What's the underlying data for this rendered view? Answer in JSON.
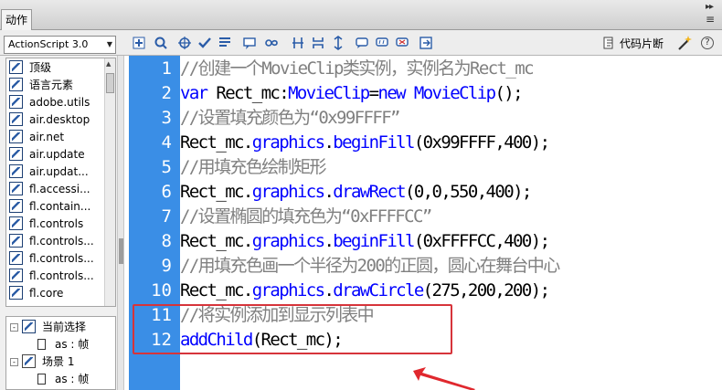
{
  "window": {
    "panel_tab": "动作"
  },
  "toolbar": {
    "language_select": "ActionScript 3.0",
    "tool_icons": [
      "add-statement-icon",
      "find-icon",
      "target-path-icon",
      "check-syntax-icon",
      "auto-format-icon",
      "code-hint-icon",
      "debug-options-icon",
      "collapse-braces-icon",
      "collapse-selection-icon",
      "expand-all-icon",
      "apply-block-comment-icon",
      "apply-line-comment-icon",
      "remove-comment-icon",
      "show-hide-toolbox-icon"
    ],
    "snippets_label": "代码片断",
    "help_label": "?"
  },
  "sidebar": {
    "items": [
      {
        "label": "顶级"
      },
      {
        "label": "语言元素"
      },
      {
        "label": "adobe.utils"
      },
      {
        "label": "air.desktop"
      },
      {
        "label": "air.net"
      },
      {
        "label": "air.update"
      },
      {
        "label": "air.updat..."
      },
      {
        "label": "fl.accessi..."
      },
      {
        "label": "fl.contain..."
      },
      {
        "label": "fl.controls"
      },
      {
        "label": "fl.controls..."
      },
      {
        "label": "fl.controls..."
      },
      {
        "label": "fl.controls..."
      },
      {
        "label": "fl.core"
      }
    ]
  },
  "script_navigator": {
    "rows": [
      {
        "label": "当前选择",
        "expander": "-"
      },
      {
        "label": "as : 帧"
      },
      {
        "label": "场景 1",
        "expander": "-"
      },
      {
        "label": "as : 帧"
      }
    ]
  },
  "editor": {
    "lines": [
      {
        "num": "1",
        "tokens": [
          {
            "t": "//创建一个MovieClip类实例，实例名为Rect_mc",
            "c": "comment"
          }
        ]
      },
      {
        "num": "2",
        "tokens": [
          {
            "t": "var",
            "c": "kw"
          },
          {
            "t": " Rect_mc:",
            "c": "plain"
          },
          {
            "t": "MovieClip",
            "c": "kw"
          },
          {
            "t": "=",
            "c": "plain"
          },
          {
            "t": "new",
            "c": "kw"
          },
          {
            "t": " ",
            "c": "plain"
          },
          {
            "t": "MovieClip",
            "c": "kw"
          },
          {
            "t": "();",
            "c": "plain"
          }
        ]
      },
      {
        "num": "3",
        "tokens": [
          {
            "t": "//设置填充颜色为“0x99FFFF”",
            "c": "comment"
          }
        ]
      },
      {
        "num": "4",
        "tokens": [
          {
            "t": "Rect_mc.",
            "c": "plain"
          },
          {
            "t": "graphics",
            "c": "kw"
          },
          {
            "t": ".",
            "c": "plain"
          },
          {
            "t": "beginFill",
            "c": "kw"
          },
          {
            "t": "(0x99FFFF,400);",
            "c": "plain"
          }
        ]
      },
      {
        "num": "5",
        "tokens": [
          {
            "t": "//用填充色绘制矩形",
            "c": "comment"
          }
        ]
      },
      {
        "num": "6",
        "tokens": [
          {
            "t": "Rect_mc.",
            "c": "plain"
          },
          {
            "t": "graphics",
            "c": "kw"
          },
          {
            "t": ".",
            "c": "plain"
          },
          {
            "t": "drawRect",
            "c": "kw"
          },
          {
            "t": "(0,0,550,400);",
            "c": "plain"
          }
        ]
      },
      {
        "num": "7",
        "tokens": [
          {
            "t": "//设置椭圆的填充色为“0xFFFFCC”",
            "c": "comment"
          }
        ]
      },
      {
        "num": "8",
        "tokens": [
          {
            "t": "Rect_mc.",
            "c": "plain"
          },
          {
            "t": "graphics",
            "c": "kw"
          },
          {
            "t": ".",
            "c": "plain"
          },
          {
            "t": "beginFill",
            "c": "kw"
          },
          {
            "t": "(0xFFFFCC,400);",
            "c": "plain"
          }
        ]
      },
      {
        "num": "9",
        "tokens": [
          {
            "t": "//用填充色画一个半径为200的正圆，圆心在舞台中心",
            "c": "comment"
          }
        ]
      },
      {
        "num": "10",
        "tokens": [
          {
            "t": "Rect_mc.",
            "c": "plain"
          },
          {
            "t": "graphics",
            "c": "kw"
          },
          {
            "t": ".",
            "c": "plain"
          },
          {
            "t": "drawCircle",
            "c": "kw"
          },
          {
            "t": "(275,200,200);",
            "c": "plain"
          }
        ]
      },
      {
        "num": "11",
        "tokens": [
          {
            "t": "//将实例添加到显示列表中",
            "c": "comment"
          }
        ]
      },
      {
        "num": "12",
        "tokens": [
          {
            "t": "addChild",
            "c": "kw"
          },
          {
            "t": "(Rect_mc);",
            "c": "plain"
          }
        ]
      }
    ]
  },
  "colors": {
    "gutter": "#3a8ee6",
    "keyword": "#0000ff",
    "comment": "#808080",
    "annotation": "#d6343a"
  }
}
